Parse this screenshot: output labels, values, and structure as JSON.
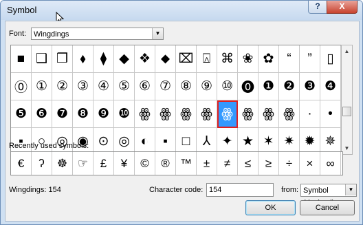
{
  "window": {
    "title": "Symbol",
    "help_label": "?",
    "close_label": "X"
  },
  "font_field": {
    "label": "Font:",
    "value": "Wingdings"
  },
  "symbols": [
    "■",
    "❑",
    "❒",
    "⬧",
    "⧫",
    "◆",
    "❖",
    "⬥",
    "⌧",
    "⍓",
    "⌘",
    "❀",
    "✿",
    "“",
    "”",
    "▯",
    "⓪",
    "①",
    "②",
    "③",
    "④",
    "⑤",
    "⑥",
    "⑦",
    "⑧",
    "⑨",
    "⑩",
    "⓿",
    "❶",
    "❷",
    "❸",
    "❹",
    "❺",
    "❻",
    "❼",
    "❽",
    "❾",
    "❿",
    "ꙮ",
    "ꙮ",
    "ꙮ",
    "ꙮ",
    "ꙮ",
    "ꙮ",
    "ꙮ",
    "ꙮ",
    "·",
    "•",
    "▪",
    "○",
    "◎",
    "◉",
    "⊙",
    "◎",
    "◐",
    "▪",
    "□",
    "⅄",
    "✦",
    "★",
    "✶",
    "✷",
    "✹",
    "✵"
  ],
  "selected_index": 42,
  "recent": {
    "label": "Recently used symbols:",
    "symbols": [
      "€",
      "ʔ",
      "☸",
      "☞",
      "£",
      "¥",
      "©",
      "®",
      "™",
      "±",
      "≠",
      "≤",
      "≥",
      "÷",
      "×",
      "∞"
    ]
  },
  "status": {
    "text": "Wingdings: 154"
  },
  "char_code": {
    "label": "Character code:",
    "value": "154"
  },
  "from": {
    "label": "from:",
    "value": "Symbol (decimal)"
  },
  "buttons": {
    "ok": "OK",
    "cancel": "Cancel"
  }
}
